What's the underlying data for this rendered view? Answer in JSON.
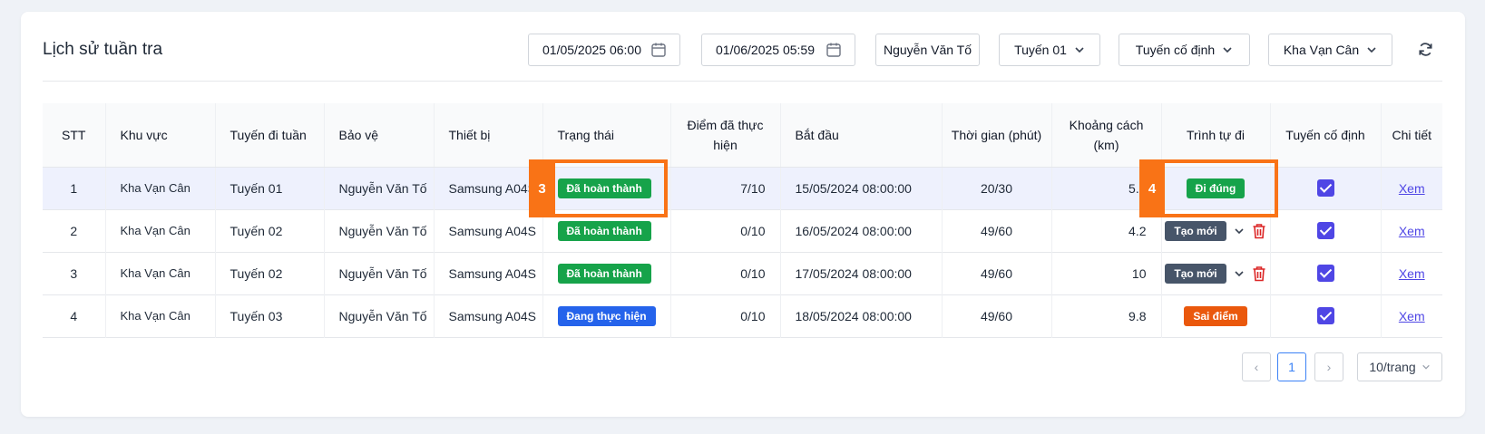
{
  "title": "Lịch sử tuần tra",
  "filters": {
    "date_from": "01/05/2025 06:00",
    "date_to": "01/06/2025 05:59",
    "guard": "Nguyễn Văn Tố",
    "route": "Tuyến 01",
    "route_type": "Tuyến cố định",
    "area": "Kha Vạn Cân"
  },
  "table": {
    "headers": {
      "stt": "STT",
      "area": "Khu vực",
      "route": "Tuyến đi tuần",
      "guard": "Bảo vệ",
      "device": "Thiết bị",
      "status": "Trạng thái",
      "points": "Điểm đã thực hiện",
      "start": "Bắt đầu",
      "time": "Thời gian (phút)",
      "distance": "Khoảng cách (km)",
      "sequence": "Trình tự đi",
      "fixed": "Tuyến cố định",
      "detail": "Chi tiết"
    },
    "rows": [
      {
        "stt": "1",
        "area": "Kha Vạn Cân",
        "route": "Tuyến 01",
        "guard": "Nguyễn Văn Tố",
        "device": "Samsung A04S",
        "status": "Đã hoàn thành",
        "points": "7/10",
        "start": "15/05/2024 08:00:00",
        "time": "20/30",
        "distance": "5.1",
        "sequence": "Đi đúng",
        "detail": "Xem"
      },
      {
        "stt": "2",
        "area": "Kha Vạn Cân",
        "route": "Tuyến 02",
        "guard": "Nguyễn Văn Tố",
        "device": "Samsung A04S",
        "status": "Đã hoàn thành",
        "points": "0/10",
        "start": "16/05/2024 08:00:00",
        "time": "49/60",
        "distance": "4.2",
        "sequence": "Tạo mới",
        "detail": "Xem"
      },
      {
        "stt": "3",
        "area": "Kha Vạn Cân",
        "route": "Tuyến 02",
        "guard": "Nguyễn Văn Tố",
        "device": "Samsung A04S",
        "status": "Đã hoàn thành",
        "points": "0/10",
        "start": "17/05/2024 08:00:00",
        "time": "49/60",
        "distance": "10",
        "sequence": "Tạo mới",
        "detail": "Xem"
      },
      {
        "stt": "4",
        "area": "Kha Vạn Cân",
        "route": "Tuyến 03",
        "guard": "Nguyễn Văn Tố",
        "device": "Samsung A04S",
        "status": "Đang thực hiện",
        "points": "0/10",
        "start": "18/05/2024 08:00:00",
        "time": "49/60",
        "distance": "9.8",
        "sequence": "Sai điểm",
        "detail": "Xem"
      }
    ]
  },
  "annotations": {
    "a": "3",
    "b": "4"
  },
  "pagination": {
    "prev": "‹",
    "current": "1",
    "next": "›",
    "page_size": "10/trang"
  },
  "colors": {
    "accent": "#4f46e5",
    "success": "#16a34a",
    "info": "#2563eb",
    "warning": "#ea580c",
    "highlight": "#f97316"
  },
  "icons": [
    "calendar-icon",
    "chevron-down-icon",
    "refresh-icon",
    "trash-icon",
    "check-icon"
  ]
}
